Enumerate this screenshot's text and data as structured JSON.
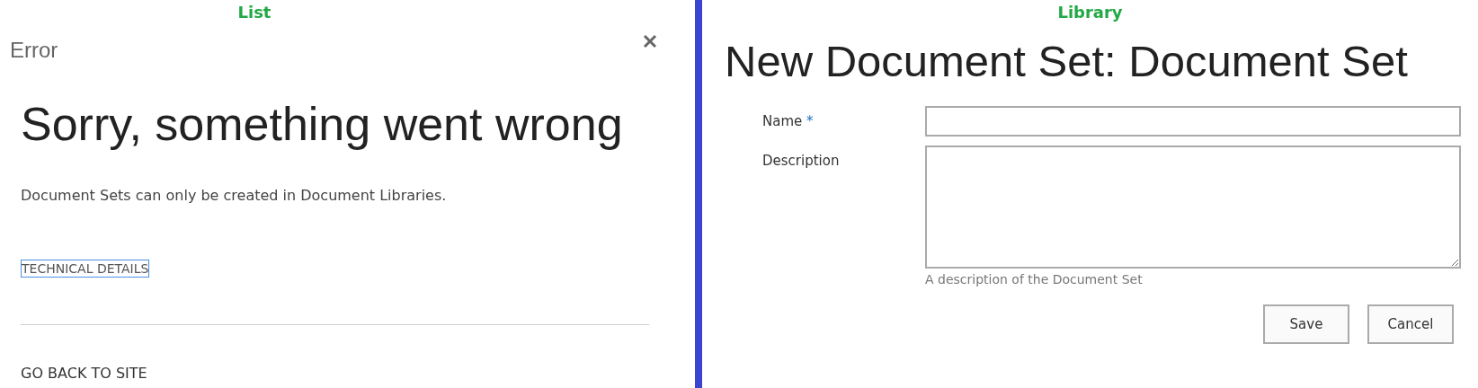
{
  "left_panel": {
    "caption": "List",
    "dialog": {
      "title": "Error",
      "heading": "Sorry, something went wrong",
      "message": "Document Sets can only be created in Document Libraries.",
      "details_link": {
        "label": "TECHNICAL DETAILS",
        "focused": true
      },
      "back_link": "GO BACK TO SITE"
    }
  },
  "right_panel": {
    "caption": "Library",
    "form": {
      "title": "New Document Set: Document Set",
      "fields": [
        {
          "kind": "text",
          "label": "Name",
          "required_mark": "*"
        },
        {
          "kind": "multiline",
          "label": "Description",
          "hint": "A description of the Document Set"
        }
      ],
      "buttons": [
        "Save",
        "Cancel"
      ]
    }
  }
}
